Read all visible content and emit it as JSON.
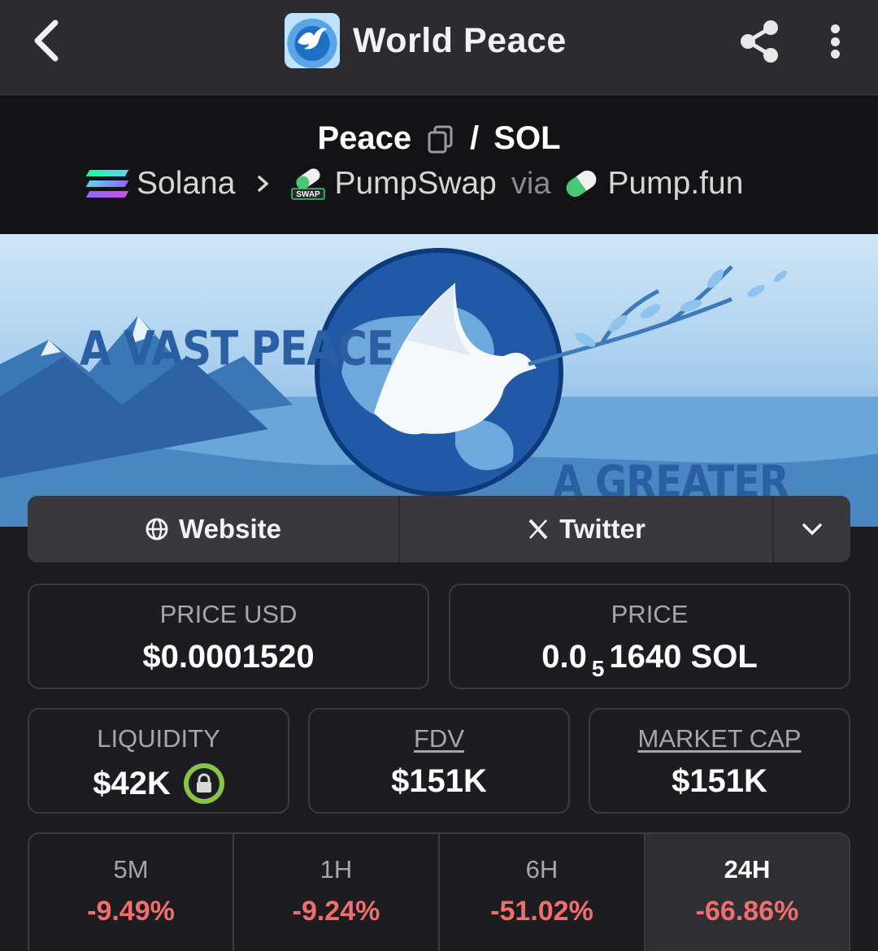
{
  "header": {
    "title": "World Peace",
    "icons": {
      "back": "chevron-left-icon",
      "share": "share-icon",
      "more": "more-vertical-icon"
    }
  },
  "pair": {
    "base": "Peace",
    "separator": "/",
    "quote": "SOL",
    "chain": "Solana",
    "dex": "PumpSwap",
    "dex_badge": "SWAP",
    "via": "via",
    "launchpad": "Pump.fun"
  },
  "banner": {
    "text_top": "A VAST PEACE",
    "text_bottom": "A GREATER WORLD"
  },
  "links": {
    "website": "Website",
    "twitter": "Twitter"
  },
  "stats": {
    "price_usd_label": "PRICE USD",
    "price_usd": "$0.0001520",
    "price_label": "PRICE",
    "price_prefix": "0.0",
    "price_zeros": "5",
    "price_suffix": "1640 SOL",
    "liquidity_label": "LIQUIDITY",
    "liquidity": "$42K",
    "fdv_label": "FDV",
    "fdv": "$151K",
    "mcap_label": "MARKET CAP",
    "mcap": "$151K"
  },
  "timeframes": [
    {
      "period": "5M",
      "change": "-9.49%"
    },
    {
      "period": "1H",
      "change": "-9.24%"
    },
    {
      "period": "6H",
      "change": "-51.02%"
    },
    {
      "period": "24H",
      "change": "-66.86%"
    }
  ],
  "colors": {
    "negative": "#f26d6d",
    "lock_badge": "#8bc34a",
    "topbar": "#2b2b30",
    "background": "#1c1c21"
  }
}
